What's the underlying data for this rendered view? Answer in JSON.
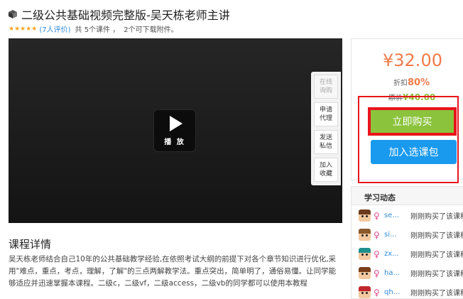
{
  "course": {
    "title": "二级公共基础视频完整版-吴天栋老师主讲",
    "stars": "★★★★★",
    "rating_text": "(7人评价)",
    "count_text": "共 5个课件 ，",
    "download_text": "2个可下载附件。"
  },
  "video": {
    "play_label": "播 放",
    "side_tools": [
      {
        "label": "在线询购",
        "disabled": true
      },
      {
        "label": "申请代理",
        "disabled": false
      },
      {
        "label": "发送私信",
        "disabled": false
      },
      {
        "label": "加入收藏",
        "disabled": false
      }
    ]
  },
  "details": {
    "title": "课程详情",
    "text": "吴天栋老师结合自己10年的公共基础教学经验,在依照考试大纲的前提下对各个章节知识进行优化,采用\"难点，重点，考点，理解，了解\"的三点两解教学法。重点突出，简单明了，通俗易懂。让同学能够适应并迅速掌握本课程。二级c，二级vf，二级access，二级vb的同学都可以使用本教程"
  },
  "purchase": {
    "price": "¥32.00",
    "discount_label": "折扣",
    "discount_value": "80%",
    "original_label": "原价",
    "original_value": "¥40.00",
    "buy_label": "立即购买",
    "add_package_label": "加入选课包",
    "accent_color": "#f07b4a",
    "buy_color": "#8bc33c",
    "add_color": "#1a9aee"
  },
  "activity": {
    "title": "学习动态",
    "items": [
      {
        "user": "se...",
        "action": "刚刚购买了该课程",
        "hair": "#6b3a1e"
      },
      {
        "user": "si...",
        "action": "刚刚购买了该课程",
        "hair": "#8a5a2b"
      },
      {
        "user": "zx...",
        "action": "刚刚购买了该课程",
        "hair": "#1f8f8f"
      },
      {
        "user": "ha...",
        "action": "刚刚购买了该课程",
        "hair": "#7a3f1a"
      },
      {
        "user": "qh...",
        "action": "刚刚购买了该课程",
        "hair": "#c0262c"
      }
    ]
  }
}
